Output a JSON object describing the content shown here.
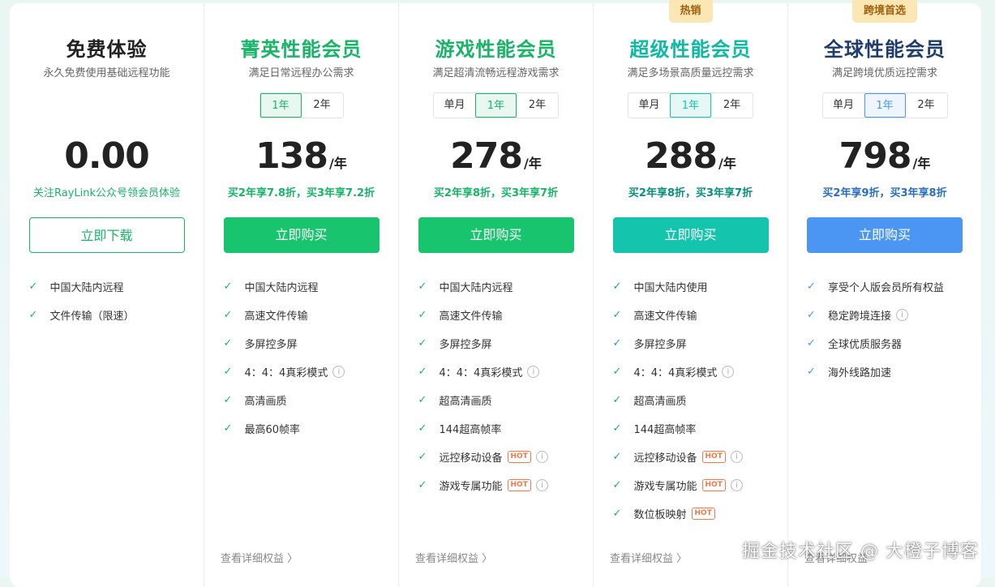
{
  "plans": [
    {
      "title": "免费体验",
      "subtitle": "永久免费使用基础远程功能",
      "tabs": [],
      "price": "0.00",
      "unit": "",
      "promo": "关注RayLink公众号领会员体验",
      "cta": "立即下载",
      "features": [
        {
          "text": "中国大陆内远程"
        },
        {
          "text": "文件传输（限速）"
        }
      ]
    },
    {
      "title": "菁英性能会员",
      "subtitle": "满足日常远程办公需求",
      "tabs": [
        "1年",
        "2年"
      ],
      "active_tab": "1年",
      "price": "138",
      "unit": "/年",
      "promo": "买2年享7.8折，买3年享7.2折",
      "cta": "立即购买",
      "features": [
        {
          "text": "中国大陆内远程"
        },
        {
          "text": "高速文件传输"
        },
        {
          "text": "多屏控多屏"
        },
        {
          "text": "4：4：4真彩模式",
          "info": true
        },
        {
          "text": "高清画质"
        },
        {
          "text": "最高60帧率"
        }
      ],
      "details": "查看详细权益 〉"
    },
    {
      "title": "游戏性能会员",
      "subtitle": "满足超清流畅远程游戏需求",
      "tabs": [
        "单月",
        "1年",
        "2年"
      ],
      "active_tab": "1年",
      "price": "278",
      "unit": "/年",
      "promo": "买2年享8折，买3年享7折",
      "cta": "立即购买",
      "features": [
        {
          "text": "中国大陆内远程"
        },
        {
          "text": "高速文件传输"
        },
        {
          "text": "多屏控多屏"
        },
        {
          "text": "4：4：4真彩模式",
          "info": true
        },
        {
          "text": "超高清画质"
        },
        {
          "text": "144超高帧率"
        },
        {
          "text": "远控移动设备",
          "hot": "HOT",
          "info": true
        },
        {
          "text": "游戏专属功能",
          "hot": "HOT",
          "info": true
        }
      ],
      "details": "查看详细权益 〉"
    },
    {
      "ribbon": "热销",
      "title": "超级性能会员",
      "subtitle": "满足多场景高质量远控需求",
      "tabs": [
        "单月",
        "1年",
        "2年"
      ],
      "active_tab": "1年",
      "price": "288",
      "unit": "/年",
      "promo": "买2年享8折，买3年享7折",
      "cta": "立即购买",
      "features": [
        {
          "text": "中国大陆内使用"
        },
        {
          "text": "高速文件传输"
        },
        {
          "text": "多屏控多屏"
        },
        {
          "text": "4：4：4真彩模式",
          "info": true
        },
        {
          "text": "超高清画质"
        },
        {
          "text": "144超高帧率"
        },
        {
          "text": "远控移动设备",
          "hot": "HOT",
          "info": true
        },
        {
          "text": "游戏专属功能",
          "hot": "HOT",
          "info": true
        },
        {
          "text": "数位板映射",
          "hot": "HOT"
        }
      ],
      "details": "查看详细权益 〉"
    },
    {
      "ribbon": "跨境首选",
      "title": "全球性能会员",
      "subtitle": "满足跨境优质远控需求",
      "tabs": [
        "单月",
        "1年",
        "2年"
      ],
      "active_tab": "1年",
      "price": "798",
      "unit": "/年",
      "promo": "买2年享9折，买3年享8折",
      "cta": "立即购买",
      "features": [
        {
          "text": "享受个人版会员所有权益"
        },
        {
          "text": "稳定跨境连接",
          "info": true
        },
        {
          "text": "全球优质服务器"
        },
        {
          "text": "海外线路加速"
        }
      ],
      "details": "查看详细权益"
    }
  ],
  "colors": {
    "green": "#19b468",
    "green_button": "#18c46d",
    "teal": "#15c4ad",
    "navy": "#1e3d6b",
    "blue": "#4a96f2",
    "blue_promo": "#2a6fbf"
  },
  "icons": {
    "check": "✓",
    "info": "i"
  },
  "watermark": "掘金技术社区 @ 大橙子博客"
}
